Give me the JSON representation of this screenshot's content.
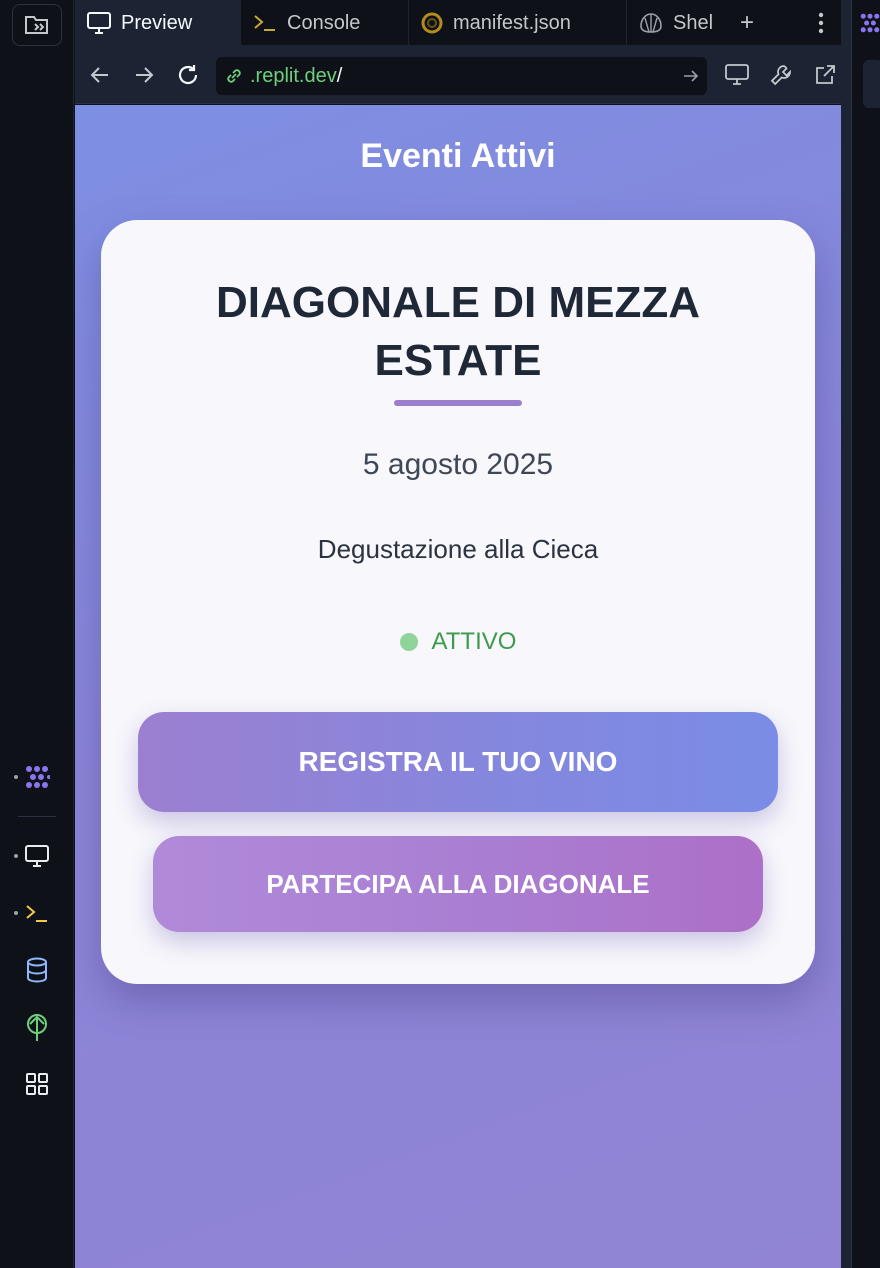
{
  "tabs": [
    {
      "label": "Preview",
      "icon": "monitor-icon",
      "active": true
    },
    {
      "label": "Console",
      "icon": "terminal-icon",
      "active": false
    },
    {
      "label": "manifest.json",
      "icon": "json-file-icon",
      "active": false
    },
    {
      "label": "Shel",
      "icon": "shell-icon",
      "active": false
    }
  ],
  "tab_add_label": "+",
  "address": {
    "host": ".replit.dev",
    "path": "/"
  },
  "page": {
    "title": "Eventi Attivi",
    "event": {
      "name": "DIAGONALE DI MEZZA ESTATE",
      "date": "5 agosto 2025",
      "type": "Degustazione alla Cieca",
      "status": "ATTIVO"
    },
    "buttons": {
      "register": "REGISTRA IL TUO VINO",
      "join": "PARTECIPA ALLA DIAGONALE"
    }
  },
  "colors": {
    "accent": "#9b7fcf",
    "status_green": "#3e9a4c",
    "url_green": "#6fcf7c",
    "ide_background": "#0e1117"
  }
}
